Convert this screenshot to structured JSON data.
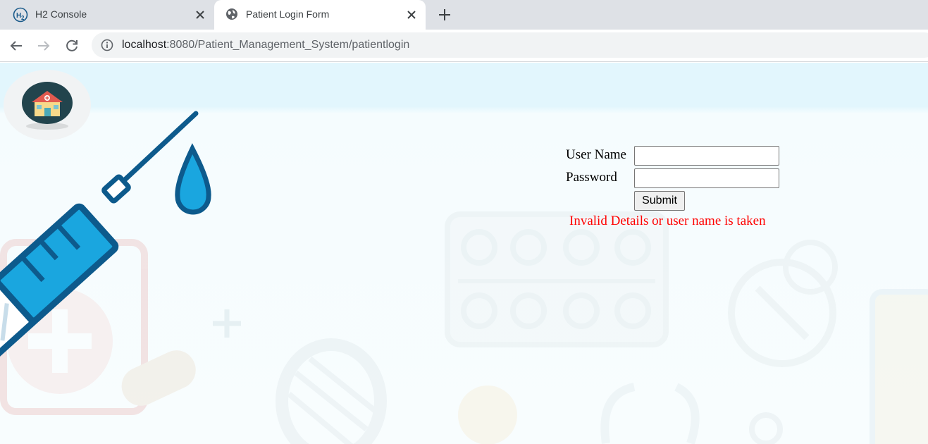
{
  "browser": {
    "tabs": [
      {
        "title": "H2 Console",
        "active": false,
        "favicon": "h2-logo-icon"
      },
      {
        "title": "Patient Login Form",
        "active": true,
        "favicon": "globe-icon"
      }
    ],
    "new_tab_icon": "plus-icon",
    "nav": {
      "back_icon": "back-arrow-icon",
      "forward_icon": "forward-arrow-icon",
      "reload_icon": "reload-icon"
    },
    "address": {
      "info_icon": "info-icon",
      "host": "localhost",
      "path": ":8080/Patient_Management_System/patientlogin"
    }
  },
  "page": {
    "logo_icon": "hospital-logo-icon",
    "form": {
      "username_label": "User Name",
      "username_value": "",
      "password_label": "Password",
      "password_value": "",
      "submit_label": "Submit",
      "error_message": "Invalid Details or user name is taken"
    },
    "colors": {
      "error": "#ff0000",
      "syringe_blue": "#0d5a8c",
      "syringe_fill": "#1aa6df",
      "page_background": "#f5fcfe"
    }
  }
}
